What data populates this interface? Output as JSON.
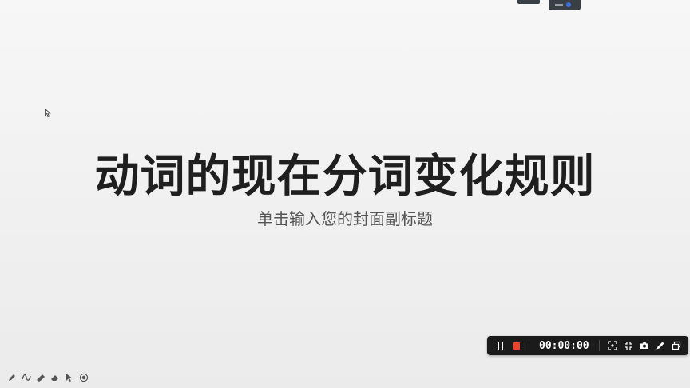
{
  "slide": {
    "title": "动词的现在分词变化规则",
    "subtitle": "单击输入您的封面副标题"
  },
  "recorder": {
    "timer": "00:00:00",
    "stop_color": "#e8452c",
    "icons": [
      "pause-icon",
      "stop-icon",
      "region-select-icon",
      "shrink-icon",
      "camera-icon",
      "pen-icon",
      "window-icon"
    ]
  },
  "annotation_tools": [
    "pen-icon",
    "curve-icon",
    "marker-icon",
    "eraser-icon",
    "pointer-icon",
    "record-target-icon"
  ]
}
